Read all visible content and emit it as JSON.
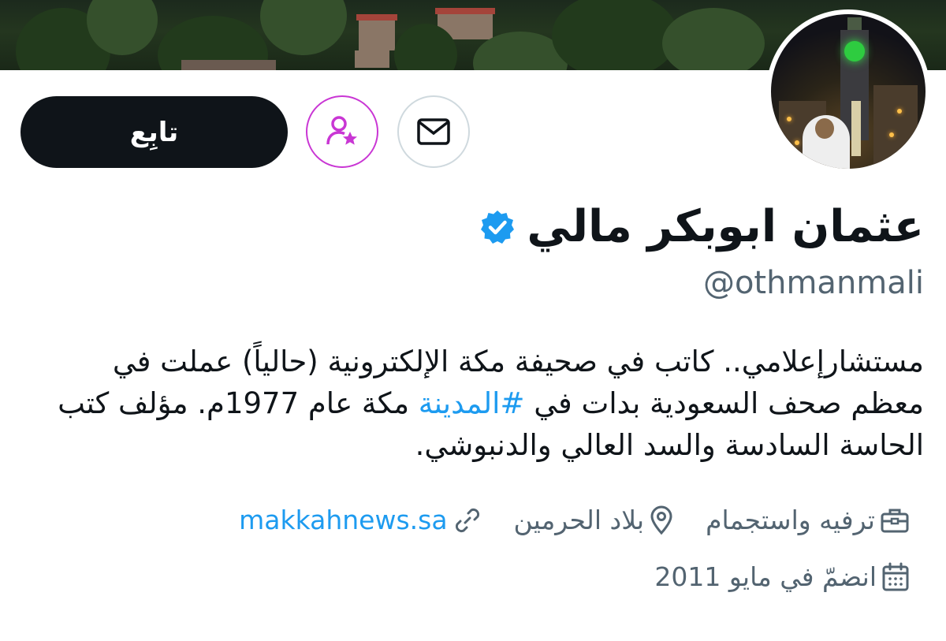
{
  "profile": {
    "display_name": "عثمان ابوبكر مالي",
    "handle": "@othmanmali",
    "verified": true,
    "bio_before_tag": "مستشارإعلامي.. كاتب في صحيفة مكة الإلكترونية (حالياً) عملت في معظم صحف السعودية بدات في ",
    "bio_hashtag": "#المدينة",
    "bio_after_tag": " مكة عام 1977م. مؤلف كتب الحاسة السادسة والسد العالي والدنبوشي."
  },
  "actions": {
    "follow_label": "تابِع",
    "subscribe_icon": "user-star-icon",
    "message_icon": "envelope-icon"
  },
  "meta": {
    "category": "ترفيه واستجمام",
    "location": "بلاد الحرمين",
    "website": "makkahnews.sa",
    "joined": "انضمّ في مايو 2011"
  },
  "colors": {
    "accent": "#1d9bf0",
    "subscribe_border": "#c936d4",
    "follow_bg": "#0f1419",
    "muted_text": "#536471"
  }
}
